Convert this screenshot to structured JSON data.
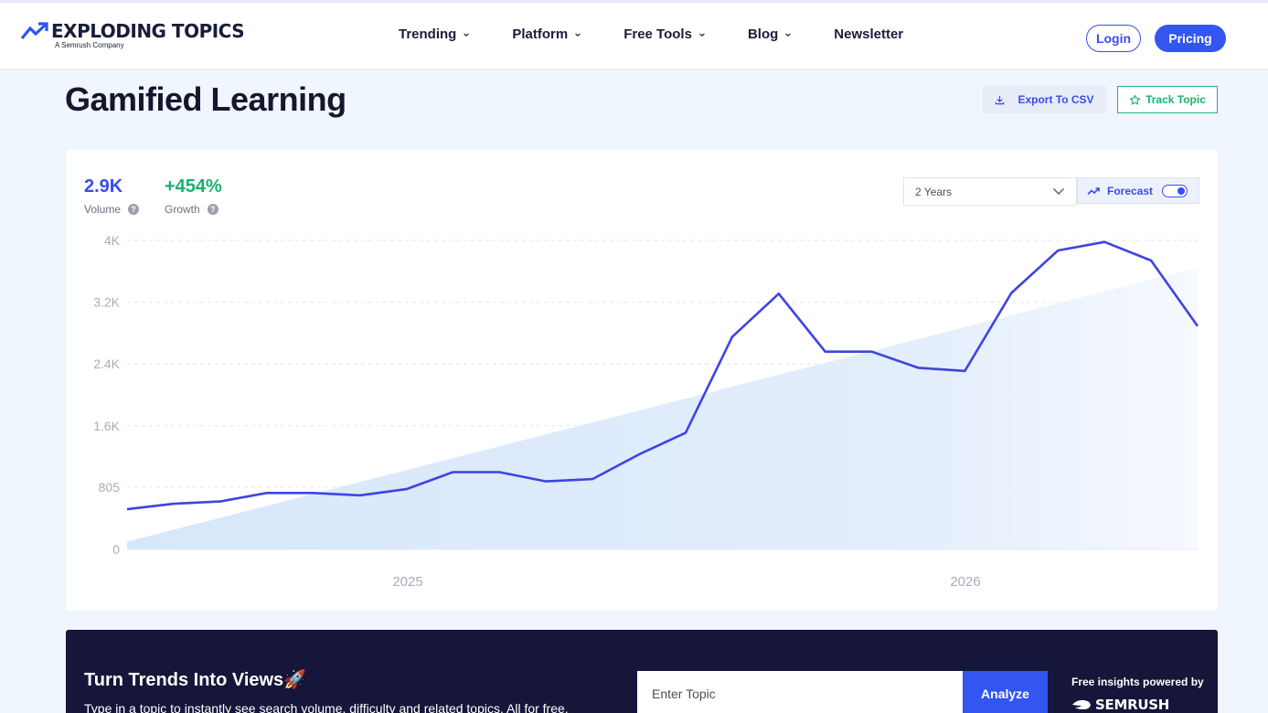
{
  "header": {
    "logo_text": "EXPLODING TOPICS",
    "logo_subtext": "A Semrush Company",
    "nav": [
      {
        "label": "Trending",
        "has_dropdown": true
      },
      {
        "label": "Platform",
        "has_dropdown": true
      },
      {
        "label": "Free Tools",
        "has_dropdown": true
      },
      {
        "label": "Blog",
        "has_dropdown": true
      },
      {
        "label": "Newsletter",
        "has_dropdown": false
      }
    ],
    "login_label": "Login",
    "pricing_label": "Pricing"
  },
  "page": {
    "title": "Gamified Learning",
    "export_label": "Export To CSV",
    "track_label": "Track Topic"
  },
  "stats": {
    "volume_value": "2.9K",
    "volume_label": "Volume",
    "growth_value": "+454%",
    "growth_label": "Growth"
  },
  "controls": {
    "range_selected": "2 Years",
    "forecast_label": "Forecast",
    "forecast_enabled": true
  },
  "colors": {
    "accent": "#3b4cf0",
    "growth": "#17b26e",
    "line": "#3d45e0",
    "trend_fill": "#dbe9fb",
    "banner_bg": "#15163a"
  },
  "chart_data": {
    "type": "line",
    "title": "",
    "xlabel": "",
    "ylabel": "",
    "ylim": [
      0,
      4000
    ],
    "y_ticks": [
      {
        "value": 0,
        "label": "0"
      },
      {
        "value": 805,
        "label": "805"
      },
      {
        "value": 1600,
        "label": "1.6K"
      },
      {
        "value": 2400,
        "label": "2.4K"
      },
      {
        "value": 3200,
        "label": "3.2K"
      },
      {
        "value": 4000,
        "label": "4K"
      }
    ],
    "x_tick_labels": [
      "2025",
      "2026"
    ],
    "grid": true,
    "series": [
      {
        "values": [
          520,
          590,
          620,
          730,
          730,
          700,
          780,
          1000,
          1000,
          880,
          910,
          1230,
          1510,
          2750,
          3310,
          2560,
          2560,
          2350,
          2310,
          3320,
          3870,
          3980,
          3740,
          2890
        ]
      }
    ],
    "trend_band": {
      "start": 100,
      "end": 3650
    }
  },
  "banner": {
    "title": "Turn Trends Into Views🚀",
    "subtitle": "Type in a topic to instantly see search volume, difficulty and related topics. All for free.",
    "input_placeholder": "Enter Topic",
    "analyze_label": "Analyze",
    "powered_by": "Free insights powered by",
    "brand": "SEMRUSH"
  }
}
